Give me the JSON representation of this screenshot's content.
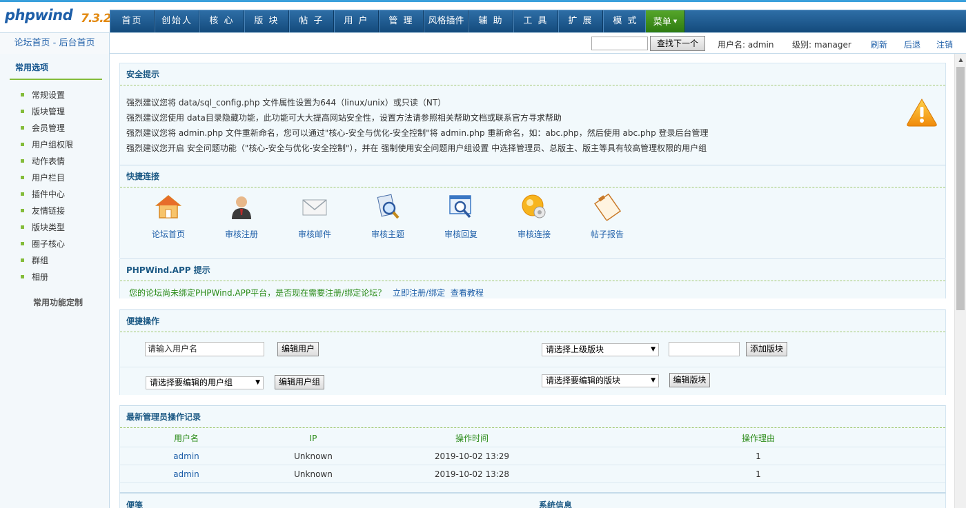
{
  "logo": {
    "brand": "phpwind",
    "version": "7.3.2"
  },
  "nav": {
    "items": [
      "首页",
      "创始人",
      "核 心",
      "版 块",
      "帖 子",
      "用 户",
      "管 理",
      "风格插件",
      "辅 助",
      "工 具",
      "扩 展",
      "模 式"
    ],
    "menu_label": "菜单"
  },
  "breadcrumb": "论坛首页 - 后台首页",
  "search": {
    "button_label": "查找下一个",
    "value": ""
  },
  "user": {
    "username_label": "用户名:",
    "username": "admin",
    "level_label": "级别:",
    "level": "manager",
    "refresh": "刷新",
    "back": "后退",
    "logout": "注销"
  },
  "sidebar": {
    "title": "常用选项",
    "items": [
      "常规设置",
      "版块管理",
      "会员管理",
      "用户组权限",
      "动作表情",
      "用户栏目",
      "插件中心",
      "友情链接",
      "版块类型",
      "圈子核心",
      "群组",
      "相册"
    ],
    "custom_label": "常用功能定制"
  },
  "security": {
    "title": "安全提示",
    "lines": [
      "强烈建议您将 data/sql_config.php 文件属性设置为644（linux/unix）或只读（NT）",
      "强烈建议您使用 data目录隐藏功能，此功能可大大提高网站安全性，设置方法请参照相关帮助文档或联系官方寻求帮助",
      "强烈建议您将 admin.php 文件重新命名，您可以通过\"核心-安全与优化-安全控制\"将 admin.php 重新命名，如：abc.php，然后使用 abc.php 登录后台管理",
      "强烈建议您开启 安全问题功能（\"核心-安全与优化-安全控制\"），并在 强制使用安全问题用户组设置 中选择管理员、总版主、版主等具有较高管理权限的用户组"
    ]
  },
  "quicklinks": {
    "title": "快捷连接",
    "items": [
      {
        "label": "论坛首页",
        "icon": "home-icon"
      },
      {
        "label": "审核注册",
        "icon": "user-icon"
      },
      {
        "label": "审核邮件",
        "icon": "mail-icon"
      },
      {
        "label": "审核主题",
        "icon": "document-search-icon"
      },
      {
        "label": "审核回复",
        "icon": "reply-search-icon"
      },
      {
        "label": "审核连接",
        "icon": "link-gear-icon"
      },
      {
        "label": "帖子报告",
        "icon": "clipboard-icon"
      }
    ]
  },
  "app": {
    "title": "PHPWind.APP 提示",
    "notice": "您的论坛尚未绑定PHPWind.APP平台，是否现在需要注册/绑定论坛？",
    "register_link": "立即注册/绑定",
    "tutorial_link": "查看教程"
  },
  "quickops": {
    "title": "便捷操作",
    "username_value": "请输入用户名",
    "edit_user_btn": "编辑用户",
    "parent_forum_select": "请选择上级版块",
    "new_forum_value": "",
    "add_forum_btn": "添加版块",
    "usergroup_select": "请选择要编辑的用户组",
    "edit_usergroup_btn": "编辑用户组",
    "forum_select": "请选择要编辑的版块",
    "edit_forum_btn": "编辑版块"
  },
  "adminlog": {
    "title": "最新管理员操作记录",
    "columns": [
      "用户名",
      "IP",
      "操作时间",
      "操作理由"
    ],
    "rows": [
      [
        "admin",
        "Unknown",
        "2019-10-02 13:29",
        "1"
      ],
      [
        "admin",
        "Unknown",
        "2019-10-02 13:28",
        "1"
      ]
    ]
  },
  "bottom": {
    "notes_title": "便笺",
    "sysinfo_title": "系统信息"
  },
  "colors": {
    "nav": "#1d5a8e",
    "accent_green": "#84bc3a",
    "link": "#1d5ea8"
  }
}
